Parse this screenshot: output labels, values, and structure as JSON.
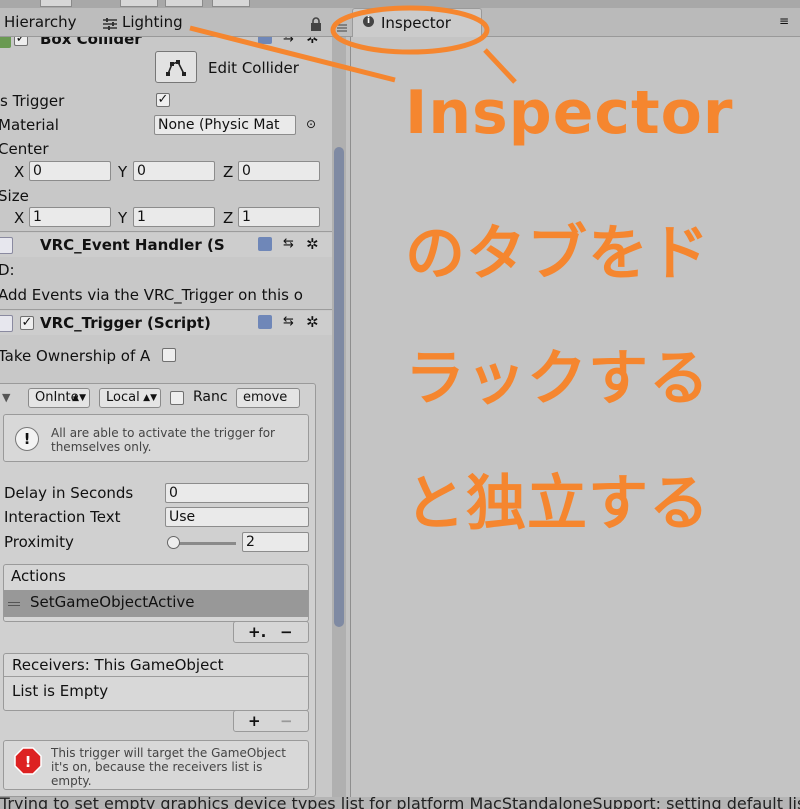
{
  "tabs": {
    "hierarchy": "Hierarchy",
    "lighting": "Lighting",
    "inspector": "Inspector"
  },
  "box_collider": {
    "title": "Box Collider",
    "edit_collider": "Edit Collider",
    "is_trigger_label": "s Trigger",
    "material_label": "Material",
    "material_value": "None (Physic Mat",
    "center_label": "Center",
    "center": {
      "x": "0",
      "y": "0",
      "z": "0"
    },
    "size_label": "Size",
    "size": {
      "x": "1",
      "y": "1",
      "z": "1"
    },
    "axis_x": "X",
    "axis_y": "Y",
    "axis_z": "Z"
  },
  "event_handler": {
    "title": "VRC_Event Handler (S",
    "id_label": "D:",
    "info": "Add Events via the VRC_Trigger on this o"
  },
  "trigger": {
    "title": "VRC_Trigger (Script)",
    "take_ownership": "Take Ownership of A",
    "dropdown_event": "OnInte",
    "dropdown_broadcast": "Local",
    "random_label": "Ranc",
    "remove_button": "emove",
    "info_text": "All are able to activate the trigger for themselves only.",
    "delay_label": "Delay in Seconds",
    "delay_value": "0",
    "interaction_label": "Interaction Text",
    "interaction_value": "Use",
    "proximity_label": "Proximity",
    "proximity_value": "2",
    "proximity_fraction": 0.02,
    "actions_header": "Actions",
    "action_item": "SetGameObjectActive",
    "add_plus": "+.",
    "remove_minus": "−",
    "receivers_header": "Receivers: This GameObject",
    "receivers_empty": "List is Empty",
    "receivers_plus": "+",
    "receivers_minus": "−",
    "warning_text": "This trigger will target the GameObject it's on, because the receivers list is empty."
  },
  "annotation": {
    "line1": "Inspector",
    "line2": "のタブをド",
    "line3": "ラックする",
    "line4": "と独立する",
    "color": "#f5862f"
  },
  "status_bar": "Trying to set empty graphics device types list for platform MacStandaloneSupport; setting default list"
}
